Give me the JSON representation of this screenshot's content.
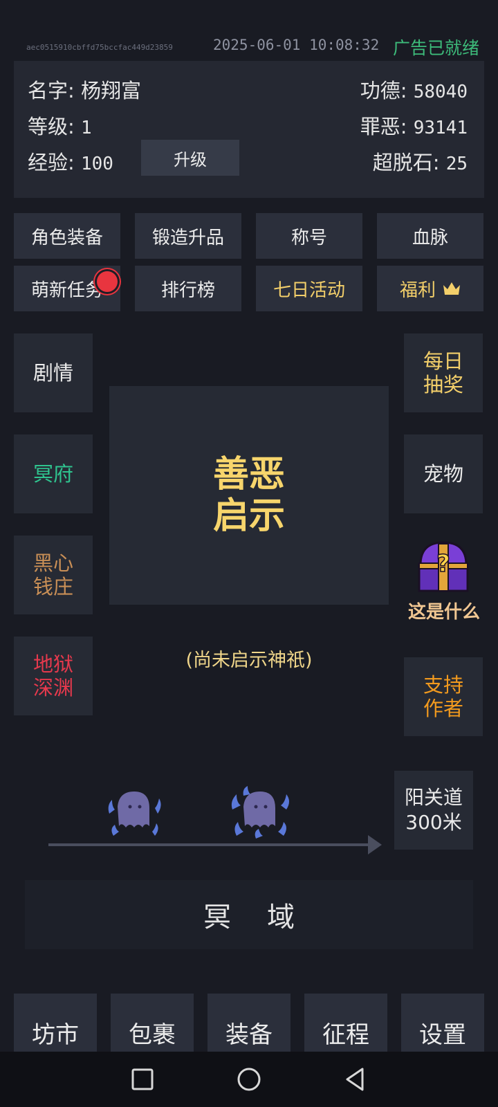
{
  "status": {
    "hash": "aec0515910cbffd75bccfac449d23859",
    "datetime": "2025-06-01 10:08:32",
    "ad": "广告已就绪"
  },
  "profile": {
    "name_label": "名字:",
    "name": "杨翔富",
    "level_label": "等级:",
    "level": "1",
    "exp_label": "经验:",
    "exp": "100",
    "upgrade_button": "升级",
    "merit_label": "功德:",
    "merit": "58040",
    "sin_label": "罪恶:",
    "sin": "93141",
    "stone_label": "超脱石:",
    "stone": "25"
  },
  "menu": {
    "row1": [
      "角色装备",
      "锻造升品",
      "称号",
      "血脉"
    ],
    "row2": [
      "萌新任务",
      "排行榜",
      "七日活动",
      "福利"
    ]
  },
  "left_side": [
    "剧情",
    "冥府",
    "黑心\n钱庄",
    "地狱\n深渊"
  ],
  "right_side": {
    "daily_draw": "每日\n抽奖",
    "pet": "宠物",
    "mystery": "这是什么",
    "support": "支持\n作者"
  },
  "center": {
    "title": "善恶\n启示",
    "subtitle": "(尚未启示神祇)"
  },
  "road": {
    "destination": "阳关道\n300米"
  },
  "area": "冥域",
  "bottom_nav": [
    "坊市",
    "包裹",
    "装备",
    "征程",
    "设置"
  ],
  "colors": {
    "green": "#3dbb7a",
    "gold": "#f3cf6a",
    "cyan_green": "#2fc48f",
    "brown": "#c98f56",
    "red": "#e5394d",
    "orange": "#f29a1e"
  },
  "icons": [
    "badge-dot-icon",
    "crown-icon",
    "treasure-chest-icon",
    "ghost-icon",
    "arrow-right-icon",
    "recents-icon",
    "home-icon",
    "back-icon"
  ]
}
